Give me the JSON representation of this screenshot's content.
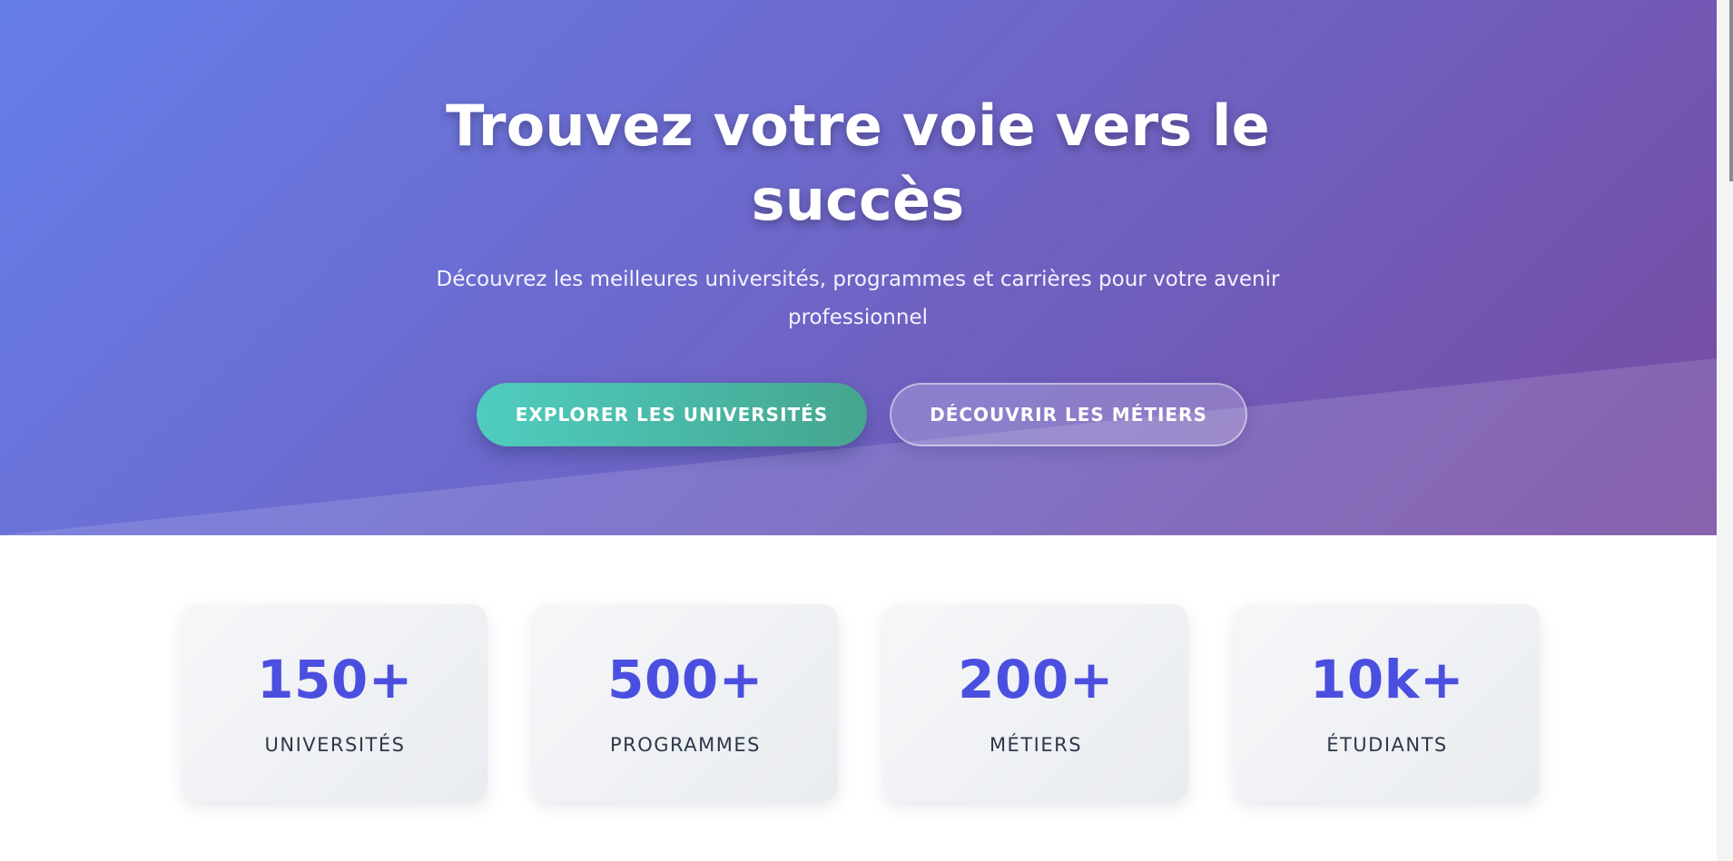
{
  "hero": {
    "title": "Trouvez votre voie vers le\nsuccès",
    "subtitle": "Découvrez les meilleures universités, programmes et carrières pour votre avenir\nprofessionnel",
    "primary_button": "EXPLORER LES UNIVERSITÉS",
    "secondary_button": "DÉCOUVRIR LES MÉTIERS",
    "gradient_start": "#667eea",
    "gradient_end": "#764ba2"
  },
  "stats": [
    {
      "value": "150+",
      "label": "UNIVERSITÉS"
    },
    {
      "value": "500+",
      "label": "PROGRAMMES"
    },
    {
      "value": "200+",
      "label": "MÉTIERS"
    },
    {
      "value": "10k+",
      "label": "ÉTUDIANTS"
    }
  ],
  "colors": {
    "stat_value": "#4b4fe0",
    "stat_label": "#2c3948",
    "primary_button_start": "#4fcdc0",
    "primary_button_end": "#45a58e"
  }
}
